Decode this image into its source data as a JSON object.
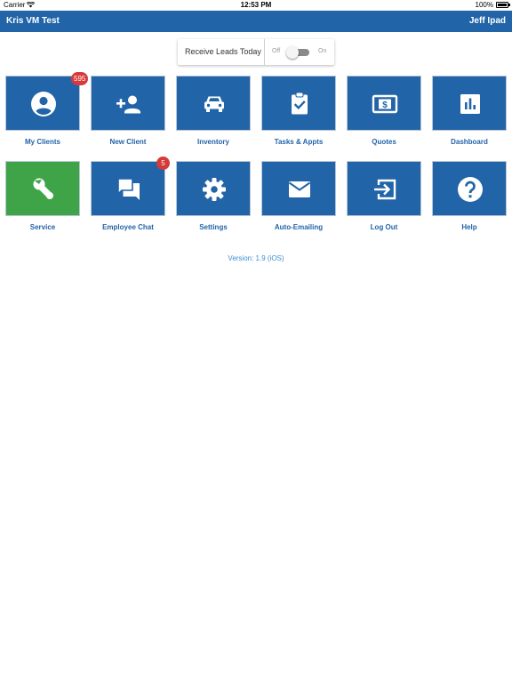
{
  "status_bar": {
    "carrier": "Carrier",
    "time": "12:53 PM",
    "battery": "100%"
  },
  "header": {
    "title": "Kris VM Test",
    "user": "Jeff Ipad"
  },
  "leads_toggle": {
    "label": "Receive Leads Today",
    "off_label": "Off",
    "on_label": "On",
    "state": "off"
  },
  "colors": {
    "header": "#2264a8",
    "tile": "#2264a8",
    "tile_active": "#3fa447",
    "badge": "#d63a3a",
    "version": "#3b8fd0"
  },
  "tiles": [
    {
      "label": "My Clients",
      "icon": "account-circle-icon",
      "badge": "595"
    },
    {
      "label": "New Client",
      "icon": "person-add-icon"
    },
    {
      "label": "Inventory",
      "icon": "car-icon"
    },
    {
      "label": "Tasks & Appts",
      "icon": "clipboard-check-icon"
    },
    {
      "label": "Quotes",
      "icon": "dollar-bill-icon"
    },
    {
      "label": "Dashboard",
      "icon": "bar-chart-icon"
    },
    {
      "label": "Service",
      "icon": "wrench-icon"
    },
    {
      "label": "Employee Chat",
      "icon": "chat-bubbles-icon",
      "badge": "5"
    },
    {
      "label": "Settings",
      "icon": "gear-icon"
    },
    {
      "label": "Auto-Emailing",
      "icon": "envelope-icon"
    },
    {
      "label": "Log Out",
      "icon": "exit-icon"
    },
    {
      "label": "Help",
      "icon": "help-circle-icon"
    }
  ],
  "version": "Version: 1.9 (iOS)"
}
